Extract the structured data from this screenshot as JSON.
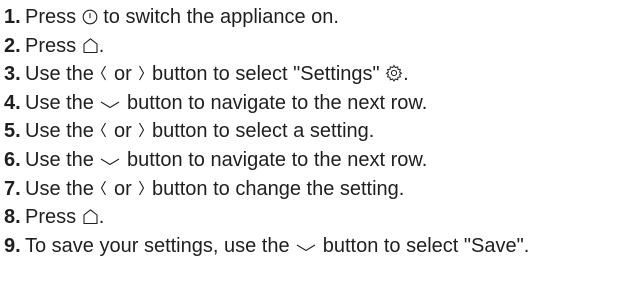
{
  "steps": [
    {
      "number": "1.",
      "parts": [
        "Press ",
        {
          "icon": "power-icon"
        },
        " to switch the appliance on."
      ]
    },
    {
      "number": "2.",
      "parts": [
        "Press ",
        {
          "icon": "home-icon"
        },
        "."
      ]
    },
    {
      "number": "3.",
      "parts": [
        "Use the ",
        {
          "icon": "chevron-left-icon"
        },
        " or ",
        {
          "icon": "chevron-right-icon"
        },
        " button to select \"Settings\" ",
        {
          "icon": "settings-gear-icon"
        },
        "."
      ]
    },
    {
      "number": "4.",
      "parts": [
        "Use the ",
        {
          "icon": "chevron-down-icon"
        },
        " button to navigate to the next row."
      ]
    },
    {
      "number": "5.",
      "parts": [
        "Use the ",
        {
          "icon": "chevron-left-icon"
        },
        " or ",
        {
          "icon": "chevron-right-icon"
        },
        " button to select a setting."
      ]
    },
    {
      "number": "6.",
      "parts": [
        "Use the ",
        {
          "icon": "chevron-down-icon"
        },
        " button to navigate to the next row."
      ]
    },
    {
      "number": "7.",
      "parts": [
        "Use the ",
        {
          "icon": "chevron-left-icon"
        },
        " or ",
        {
          "icon": "chevron-right-icon"
        },
        " button to change the setting."
      ]
    },
    {
      "number": "8.",
      "parts": [
        "Press ",
        {
          "icon": "home-icon"
        },
        "."
      ]
    },
    {
      "number": "9.",
      "parts": [
        "To save your settings, use the ",
        {
          "icon": "chevron-down-icon"
        },
        " button to select \"Save\"."
      ]
    }
  ],
  "colors": {
    "text": "#1f1f1f",
    "background": "#ffffff"
  }
}
